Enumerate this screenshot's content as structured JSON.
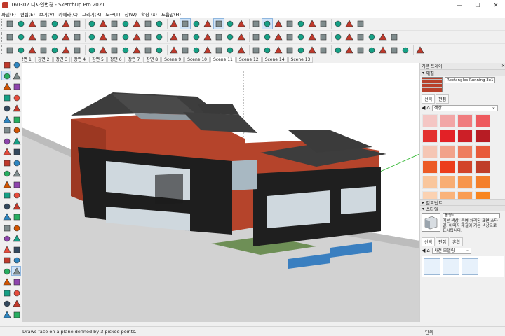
{
  "window": {
    "title": "160302 디자인변경 - SketchUp Pro 2021",
    "controls": [
      "—",
      "☐",
      "✕"
    ]
  },
  "menu": [
    "파일(F)",
    "편집(E)",
    "보기(V)",
    "카메라(C)",
    "그리기(R)",
    "도구(T)",
    "창(W)",
    "확장 (x)",
    "도움말(H)"
  ],
  "scenes": [
    {
      "label": "장면 1",
      "selected": false
    },
    {
      "label": "장면 2",
      "selected": false
    },
    {
      "label": "장면 3",
      "selected": false
    },
    {
      "label": "장면 4",
      "selected": false
    },
    {
      "label": "장면 5",
      "selected": false
    },
    {
      "label": "장면 6",
      "selected": false
    },
    {
      "label": "장면 7",
      "selected": false
    },
    {
      "label": "장면 8",
      "selected": false
    },
    {
      "label": "Scene 9",
      "selected": false
    },
    {
      "label": "Scene 10",
      "selected": false
    },
    {
      "label": "Scene 11",
      "selected": true
    },
    {
      "label": "Scene 12",
      "selected": false
    },
    {
      "label": "Scene 14",
      "selected": false
    },
    {
      "label": "Scene 13",
      "selected": false
    }
  ],
  "status": {
    "text": "Draws face on a plane defined by 3 picked points.",
    "unit_label": "단위"
  },
  "tray": {
    "title": "기본 트레이",
    "materials": {
      "section_title": "재질",
      "current_name": "Rectangles Running 3x1",
      "tabs": [
        {
          "label": "선택",
          "selected": true
        },
        {
          "label": "편집",
          "selected": false
        }
      ],
      "library": "색상",
      "swatches": [
        "#f4c6c4",
        "#f2a6a6",
        "#f07c7e",
        "#ee5a5e",
        "#e3312f",
        "#e32126",
        "#cc1f27",
        "#b71c24",
        "#f5c6b4",
        "#f2a28a",
        "#ee7d5f",
        "#e85a3a",
        "#ec5a24",
        "#ec3d1c",
        "#d2442a",
        "#bf3e29",
        "#f9c69c",
        "#f8ad73",
        "#f7954c",
        "#f47f2b",
        "#fbd2b2",
        "#fab37a",
        "#f99d54",
        "#f8851f"
      ]
    },
    "components": {
      "section_title": "컴포넌트"
    },
    "styles": {
      "section_title": "스타일",
      "name": "음영1",
      "description": "기본 색상, 음영 처리된 표면 스타일. 이미지 재질이 기본 색상으로 표시됩니다.",
      "tabs": [
        {
          "label": "선택",
          "selected": true
        },
        {
          "label": "편집",
          "selected": false
        },
        {
          "label": "혼합",
          "selected": false
        }
      ],
      "collection": "사전 모델링"
    }
  }
}
